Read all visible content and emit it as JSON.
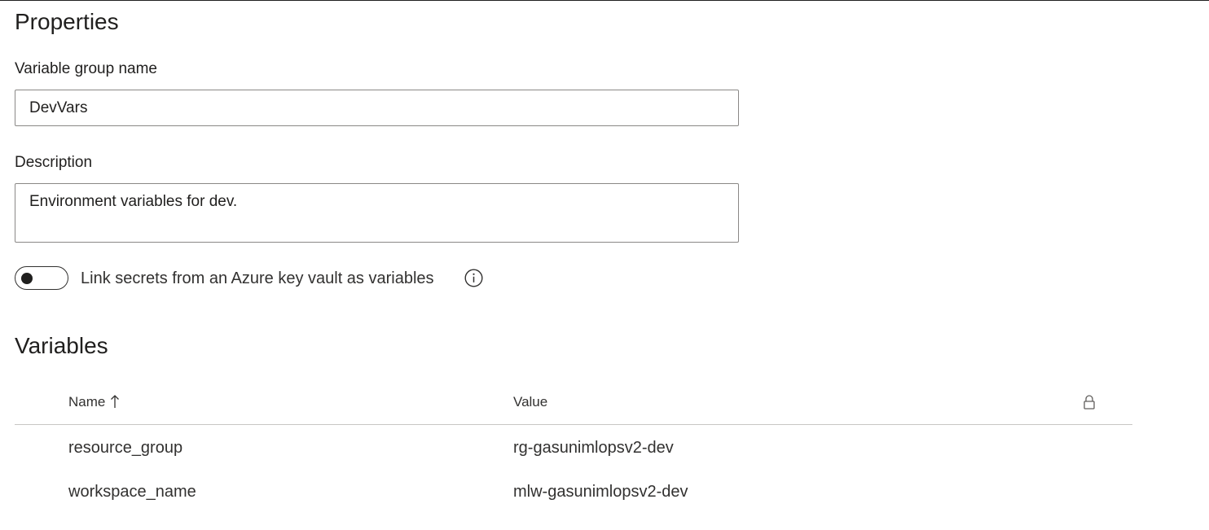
{
  "properties": {
    "title": "Properties",
    "name_label": "Variable group name",
    "name_value": "DevVars",
    "description_label": "Description",
    "description_value": "Environment variables for dev.",
    "keyvault_toggle": {
      "label": "Link secrets from an Azure key vault as variables",
      "state": "off",
      "info_icon": "info-icon"
    }
  },
  "variables": {
    "title": "Variables",
    "columns": {
      "name": "Name",
      "name_sort": "ascending",
      "value": "Value",
      "secret_icon": "lock-icon"
    },
    "rows": [
      {
        "name": "resource_group",
        "value": "rg-gasunimlopsv2-dev"
      },
      {
        "name": "workspace_name",
        "value": "mlw-gasunimlopsv2-dev"
      }
    ]
  }
}
